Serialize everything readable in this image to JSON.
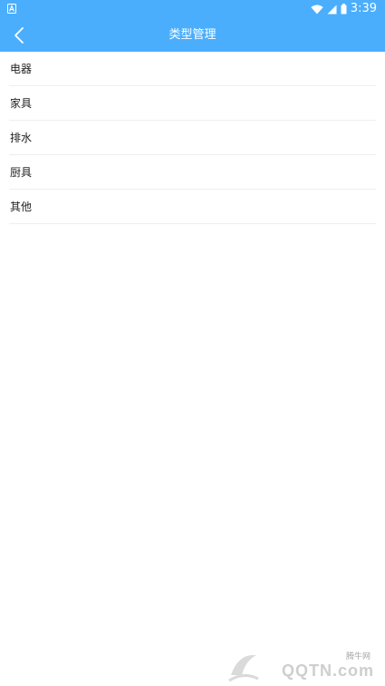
{
  "status_bar": {
    "time": "3:39",
    "left_icon": "notification-a-icon",
    "icons": [
      "wifi-icon",
      "cell-signal-icon",
      "battery-icon"
    ]
  },
  "app_bar": {
    "title": "类型管理",
    "back_icon": "back-arrow-icon"
  },
  "type_list": {
    "items": [
      {
        "label": "电器"
      },
      {
        "label": "家具"
      },
      {
        "label": "排水"
      },
      {
        "label": "厨具"
      },
      {
        "label": "其他"
      }
    ]
  },
  "watermark": {
    "small_text": "腾牛网",
    "main_text": "QQTN.com"
  },
  "colors": {
    "accent": "#4aaefc",
    "divider": "#eeeeee",
    "text": "#222222"
  }
}
